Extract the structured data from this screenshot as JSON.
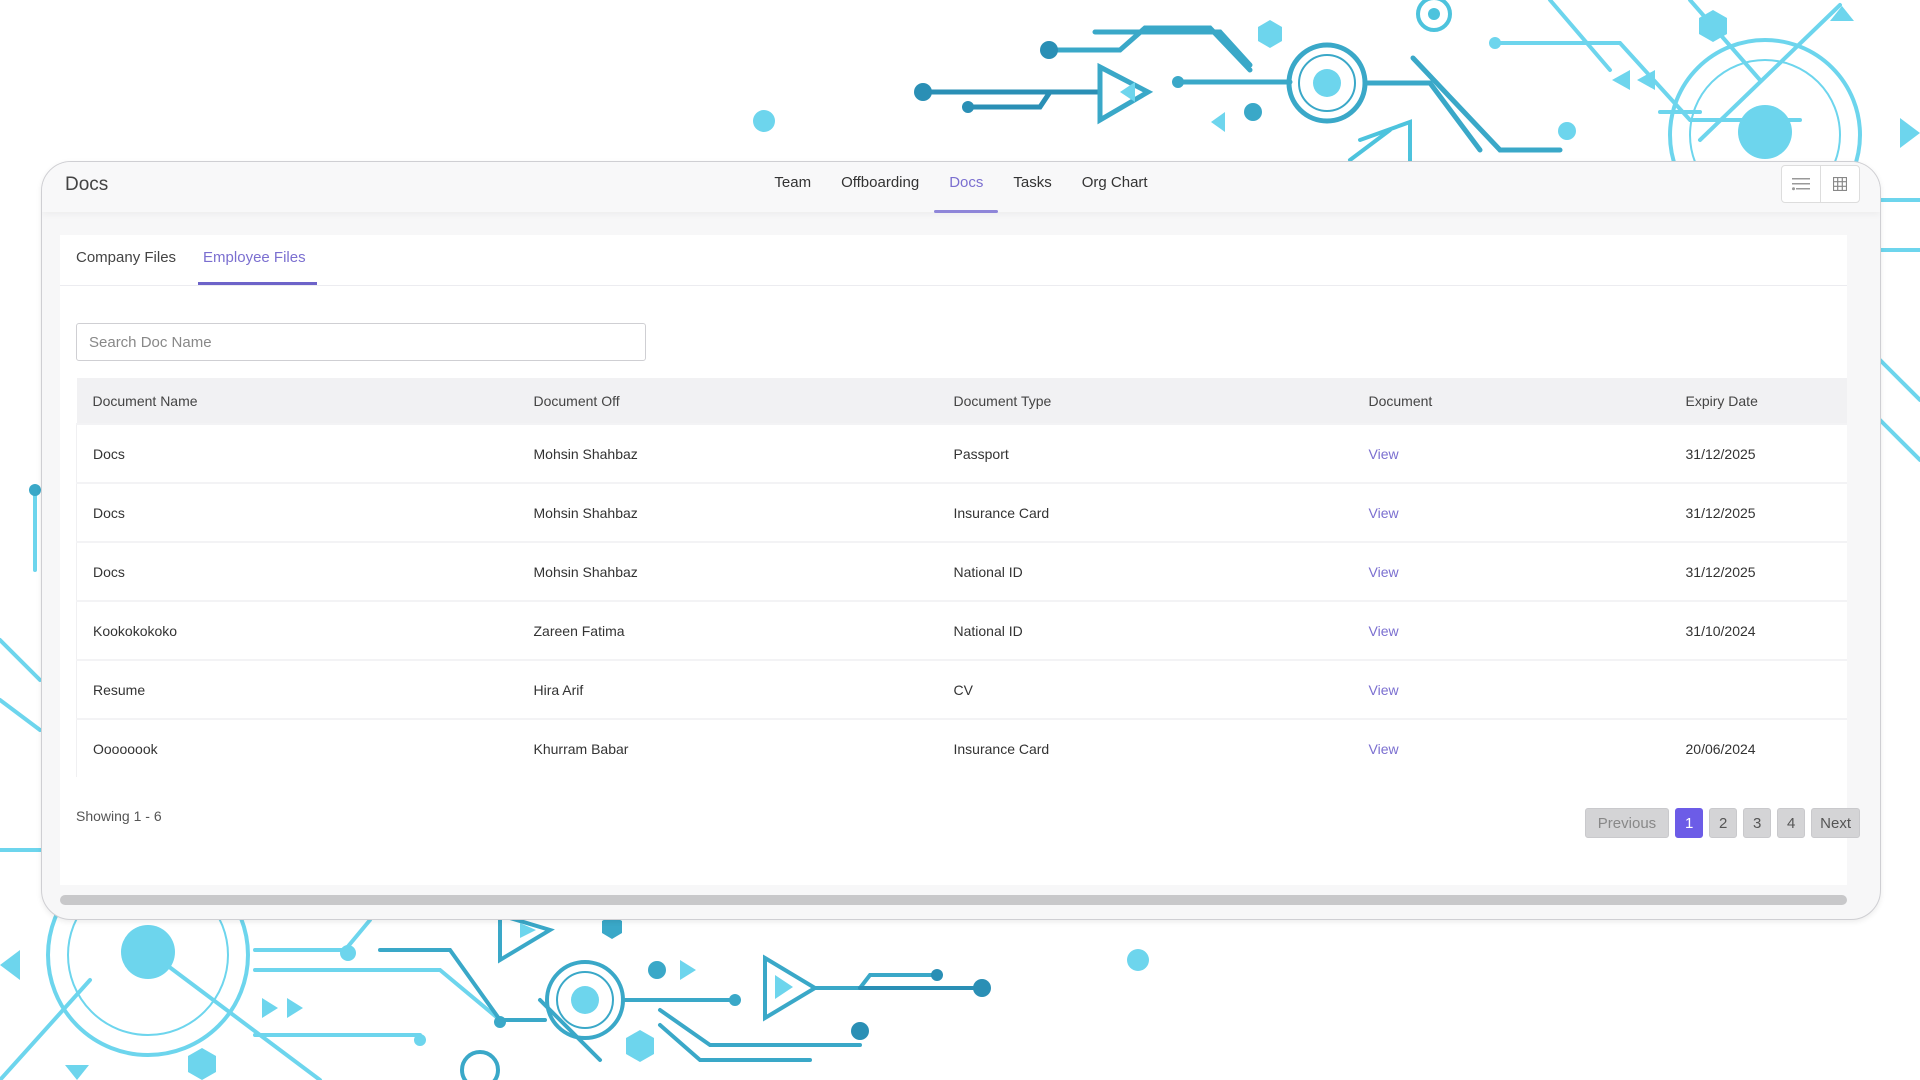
{
  "app": {
    "title": "Docs"
  },
  "nav": {
    "items": [
      {
        "label": "Team",
        "active": false
      },
      {
        "label": "Offboarding",
        "active": false
      },
      {
        "label": "Docs",
        "active": true
      },
      {
        "label": "Tasks",
        "active": false
      },
      {
        "label": "Org Chart",
        "active": false
      }
    ]
  },
  "view_toggle": {
    "list_icon": "list-icon",
    "grid_icon": "grid-icon"
  },
  "subtabs": [
    {
      "label": "Company Files",
      "active": false
    },
    {
      "label": "Employee Files",
      "active": true
    }
  ],
  "search": {
    "placeholder": "Search Doc Name",
    "value": ""
  },
  "table": {
    "columns": [
      "Document Name",
      "Document Off",
      "Document Type",
      "Document",
      "Expiry Date"
    ],
    "rows": [
      {
        "name": "Docs",
        "owner": "Mohsin Shahbaz",
        "type": "Passport",
        "document": "View",
        "expiry": "31/12/2025"
      },
      {
        "name": "Docs",
        "owner": "Mohsin Shahbaz",
        "type": "Insurance Card",
        "document": "View",
        "expiry": "31/12/2025"
      },
      {
        "name": "Docs",
        "owner": "Mohsin Shahbaz",
        "type": "National ID",
        "document": "View",
        "expiry": "31/12/2025"
      },
      {
        "name": "Kookokokoko",
        "owner": "Zareen Fatima",
        "type": "National ID",
        "document": "View",
        "expiry": "31/10/2024"
      },
      {
        "name": "Resume",
        "owner": "Hira Arif",
        "type": "CV",
        "document": "View",
        "expiry": ""
      },
      {
        "name": "Oooooook",
        "owner": "Khurram Babar",
        "type": "Insurance Card",
        "document": "View",
        "expiry": "20/06/2024"
      }
    ]
  },
  "footer": {
    "showing": "Showing 1 - 6",
    "pagination": {
      "previous": "Previous",
      "pages": [
        "1",
        "2",
        "3",
        "4"
      ],
      "current": "1",
      "next": "Next"
    }
  },
  "colors": {
    "accent": "#7b6fd0",
    "active_page": "#6c5ce7",
    "decor_light": "#6dd5ed",
    "decor_mid": "#4dc3dd",
    "decor_dark": "#2a8fb5"
  }
}
